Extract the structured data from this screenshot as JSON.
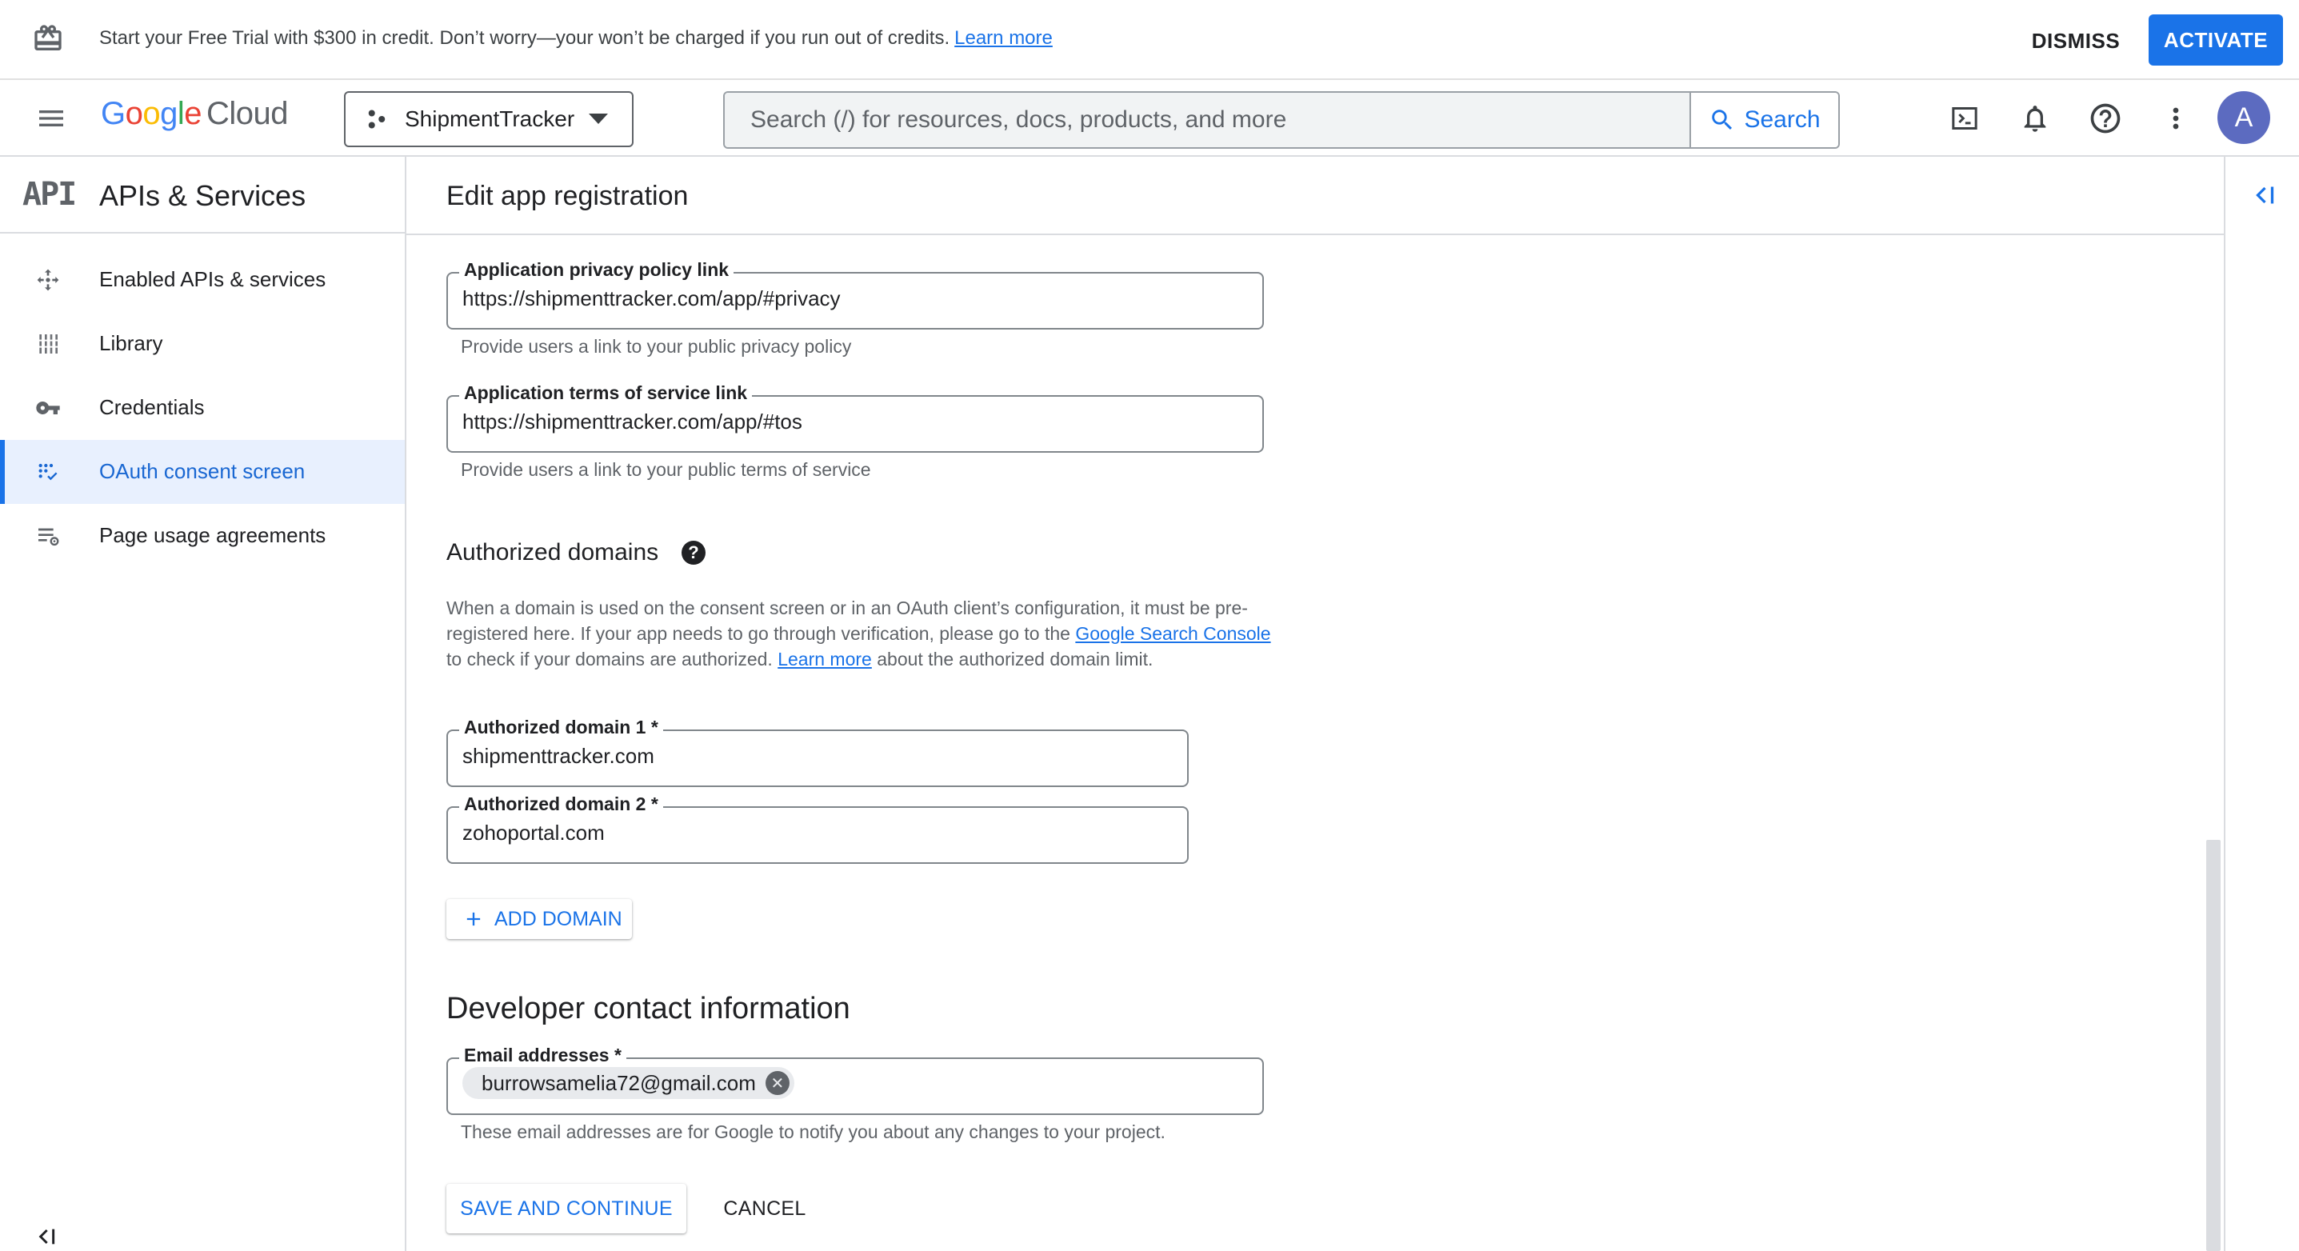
{
  "banner": {
    "message": "Start your Free Trial with $300 in credit. Don’t worry—your won’t be charged if you run out of credits.",
    "learn_more": "Learn more",
    "dismiss_label": "DISMISS",
    "activate_label": "ACTIVATE"
  },
  "topbar": {
    "logo_google": "Google",
    "logo_cloud": "Cloud",
    "project_name": "ShipmentTracker",
    "search_placeholder": "Search (/) for resources, docs, products, and more",
    "search_button": "Search",
    "avatar_letter": "A"
  },
  "sidebar": {
    "badge": "API",
    "title": "APIs & Services",
    "items": [
      {
        "label": "Enabled APIs & services",
        "icon": "enabled-apis-icon",
        "active": false
      },
      {
        "label": "Library",
        "icon": "library-icon",
        "active": false
      },
      {
        "label": "Credentials",
        "icon": "key-icon",
        "active": false
      },
      {
        "label": "OAuth consent screen",
        "icon": "oauth-consent-icon",
        "active": true
      },
      {
        "label": "Page usage agreements",
        "icon": "settings-list-icon",
        "active": false
      }
    ]
  },
  "main": {
    "title": "Edit app registration",
    "privacy": {
      "label": "Application privacy policy link",
      "value": "https://shipmenttracker.com/app/#privacy",
      "hint": "Provide users a link to your public privacy policy"
    },
    "tos": {
      "label": "Application terms of service link",
      "value": "https://shipmenttracker.com/app/#tos",
      "hint": "Provide users a link to your public terms of service"
    },
    "domains": {
      "title": "Authorized domains",
      "help": "?",
      "desc_1": "When a domain is used on the consent screen or in an OAuth client’s configuration, it must be pre-registered here. If your app needs to go through verification, please go to the ",
      "desc_link_1": "Google Search Console",
      "desc_2": " to check if your domains are authorized. ",
      "desc_link_2": "Learn more",
      "desc_3": " about the authorized domain limit.",
      "domain1_label": "Authorized domain 1 *",
      "domain1_value": "shipmenttracker.com",
      "domain2_label": "Authorized domain 2 *",
      "domain2_value": "zohoportal.com",
      "add_domain": "ADD DOMAIN"
    },
    "developer": {
      "title": "Developer contact information",
      "email_label": "Email addresses *",
      "email_chip": "burrowsamelia72@gmail.com",
      "hint": "These email addresses are for Google to notify you about any changes to your project."
    },
    "save_label": "SAVE AND CONTINUE",
    "cancel_label": "CANCEL"
  },
  "colors": {
    "accent": "#1a73e8",
    "active_bg": "#e8f0fe",
    "border": "#dadce0"
  }
}
